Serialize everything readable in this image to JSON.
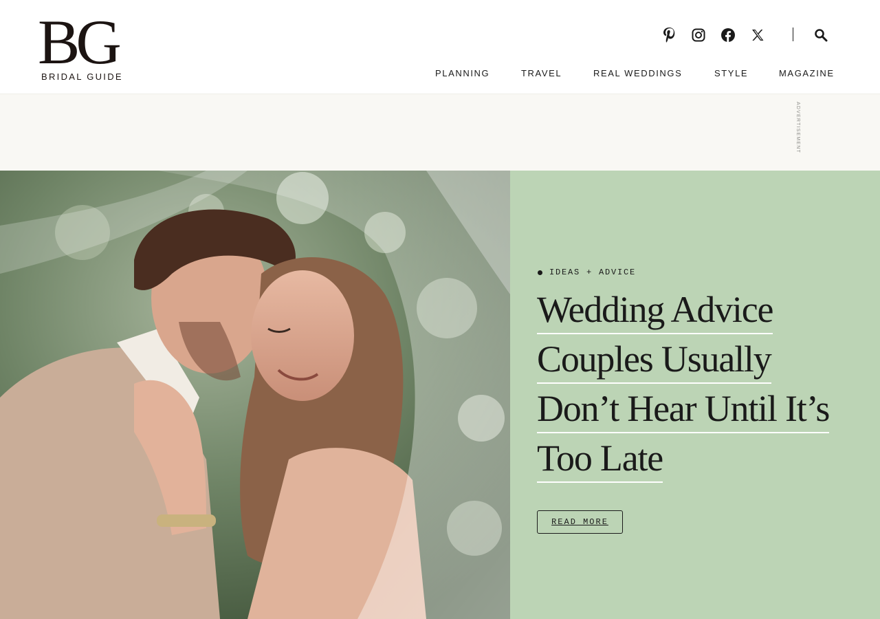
{
  "brand": {
    "logo_mark": "BG",
    "logo_name": "BRIDAL GUIDE"
  },
  "social": [
    {
      "name": "pinterest-icon"
    },
    {
      "name": "instagram-icon"
    },
    {
      "name": "facebook-icon"
    },
    {
      "name": "x-twitter-icon"
    }
  ],
  "search": {
    "icon": "search-icon"
  },
  "nav": {
    "items": [
      {
        "label": "PLANNING"
      },
      {
        "label": "TRAVEL"
      },
      {
        "label": "REAL WEDDINGS"
      },
      {
        "label": "STYLE"
      },
      {
        "label": "MAGAZINE"
      }
    ]
  },
  "ad": {
    "label": "ADVERTISEMENT"
  },
  "hero": {
    "category": "IDEAS + ADVICE",
    "headline_lines": [
      "Wedding Advice",
      "Couples Usually",
      "Don’t Hear Until It’s",
      "Too Late"
    ],
    "cta": "READ MORE",
    "panel_color": "#bcd4b5"
  },
  "colors": {
    "text": "#1a1a1a",
    "logo": "#1c1412",
    "ad_bg": "#f9f8f4",
    "panel": "#bcd4b5"
  }
}
